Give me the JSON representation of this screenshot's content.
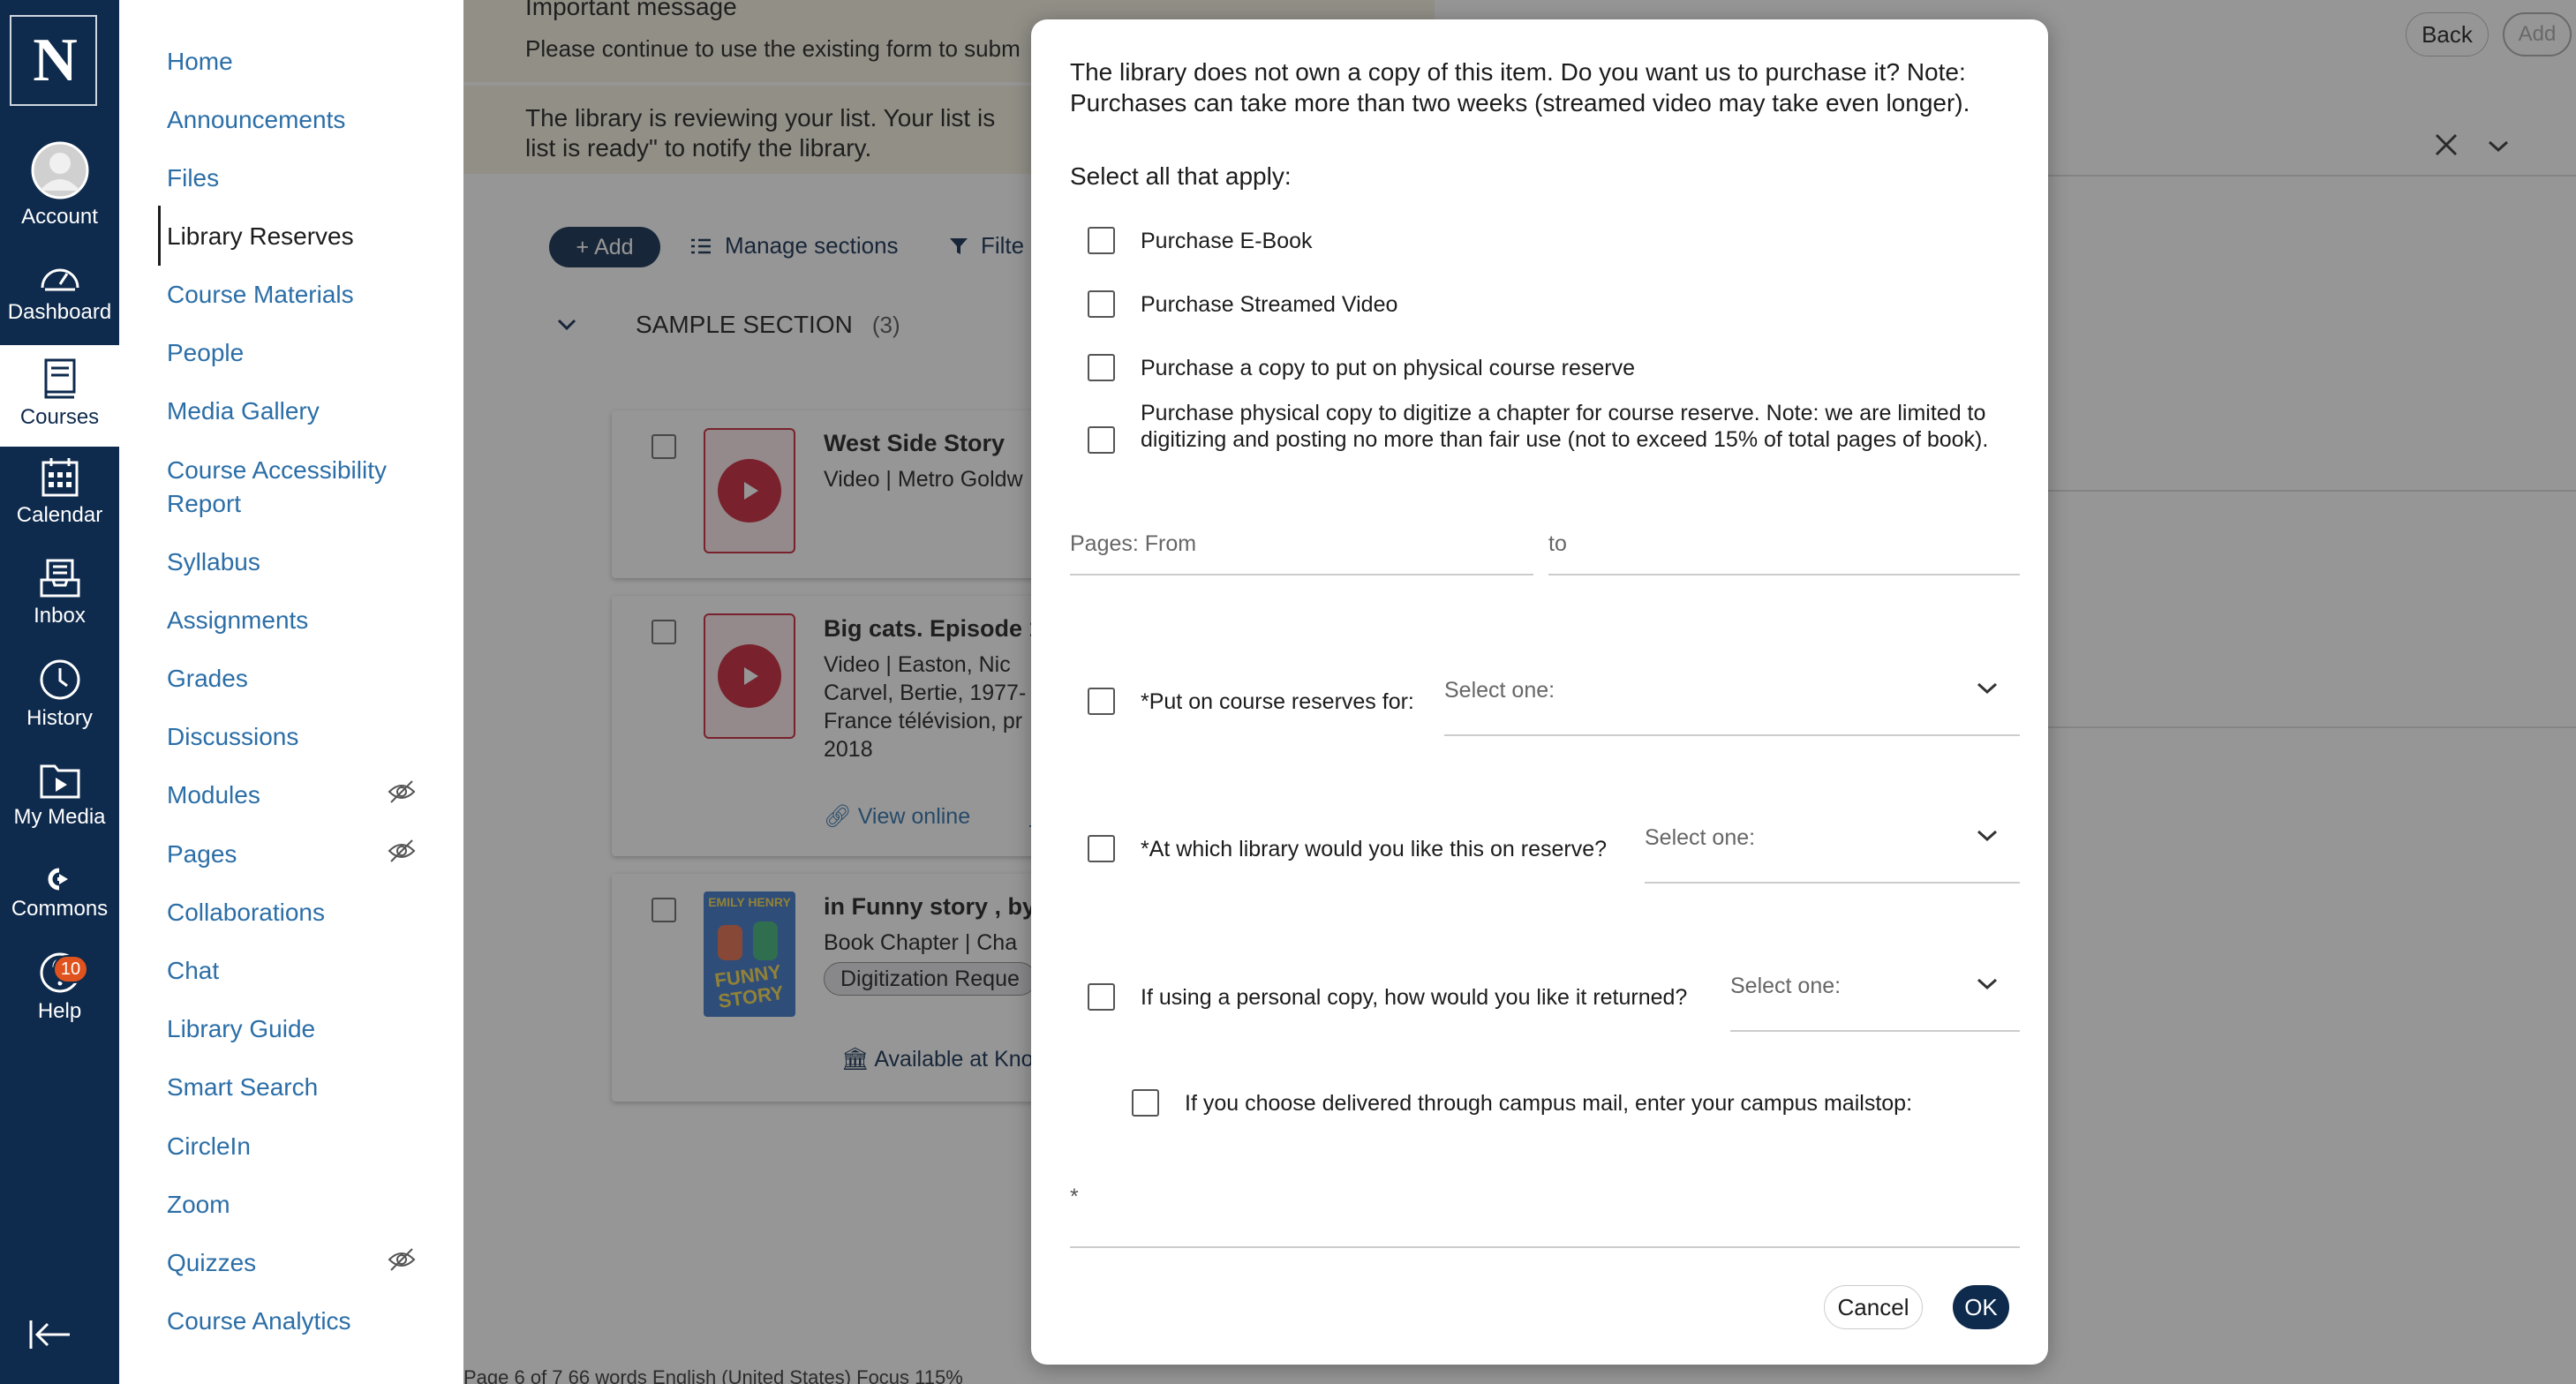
{
  "global_nav": {
    "items": [
      {
        "label": "Account",
        "icon": "account-avatar-icon"
      },
      {
        "label": "Dashboard",
        "icon": "dashboard-gauge-icon"
      },
      {
        "label": "Courses",
        "icon": "courses-book-icon",
        "active": true
      },
      {
        "label": "Calendar",
        "icon": "calendar-icon"
      },
      {
        "label": "Inbox",
        "icon": "inbox-icon"
      },
      {
        "label": "History",
        "icon": "history-clock-icon"
      },
      {
        "label": "My Media",
        "icon": "my-media-folder-icon"
      },
      {
        "label": "Commons",
        "icon": "commons-icon"
      },
      {
        "label": "Help",
        "icon": "help-icon",
        "badge": "10"
      }
    ],
    "logo_text": "N"
  },
  "course_nav": {
    "items": [
      {
        "label": "Home"
      },
      {
        "label": "Announcements"
      },
      {
        "label": "Files"
      },
      {
        "label": "Library Reserves",
        "active": true
      },
      {
        "label": "Course Materials"
      },
      {
        "label": "People"
      },
      {
        "label": "Media Gallery"
      },
      {
        "label": "Course Accessibility Report"
      },
      {
        "label": "Syllabus"
      },
      {
        "label": "Assignments"
      },
      {
        "label": "Grades"
      },
      {
        "label": "Discussions"
      },
      {
        "label": "Modules",
        "hidden": true
      },
      {
        "label": "Pages",
        "hidden": true
      },
      {
        "label": "Collaborations"
      },
      {
        "label": "Chat"
      },
      {
        "label": "Library Guide"
      },
      {
        "label": "Smart Search"
      },
      {
        "label": "CircleIn"
      },
      {
        "label": "Zoom"
      },
      {
        "label": "Quizzes",
        "hidden": true
      },
      {
        "label": "Course Analytics"
      }
    ]
  },
  "main": {
    "notice_title": "Important message",
    "notice_body": "Please continue to use the existing form to subm",
    "review_text": "The library is reviewing your list. Your list is list is ready\" to notify the library.",
    "toolbar": {
      "add": "Add",
      "manage": "Manage sections",
      "filter": "Filte"
    },
    "section": {
      "name": "SAMPLE SECTION",
      "count": "(3)"
    },
    "cards": [
      {
        "title": "West Side Story",
        "meta": "Video  |  Metro Goldw"
      },
      {
        "title": "Big cats. Episode 1",
        "meta_lines": [
          "Video  |  Easton, Nic",
          "Carvel, Bertie, 1977-",
          "France télévision, pr",
          "2018"
        ],
        "link": "View online",
        "link2": "Mo"
      },
      {
        "title": "in Funny story , by",
        "meta": "Book Chapter  |  Cha",
        "pill": "Digitization Reque",
        "availability": "Available at Kno",
        "cover_top": "EMILY HENRY",
        "cover_title": "FUNNY STORY"
      }
    ],
    "right_panel": {
      "back": "Back",
      "add": "Add"
    },
    "status_bar": "Page 6 of 7   66 words        English (United States)           Focus                              115%"
  },
  "modal": {
    "intro": "The library does not own a copy of this item. Do you want us to purchase it? Note: Purchases can take more than two weeks (streamed video may take even longer).",
    "select_all": "Select all that apply:",
    "options": [
      {
        "label": "Purchase E-Book",
        "checked": false
      },
      {
        "label": "Purchase Streamed Video",
        "checked": false
      },
      {
        "label": "Purchase a copy to put on physical course reserve",
        "checked": false
      },
      {
        "label": "Purchase physical copy to digitize a chapter for course reserve. Note: we are limited to digitizing and posting no more than fair use (not to exceed 15% of total pages of book).",
        "checked": false
      }
    ],
    "pages_from_placeholder": "Pages: From",
    "pages_to_placeholder": "to",
    "reserve_for": {
      "label": "*Put on course reserves for:",
      "value": "Select one:"
    },
    "which_library": {
      "label": "*At which library would you like this on reserve?",
      "value": "Select one:"
    },
    "personal_copy": {
      "label": "If using a personal copy, how would you like it returned?",
      "value": "Select one:"
    },
    "campus_mail": {
      "label": "If you choose delivered through campus mail, enter your campus mailstop:"
    },
    "mailstop_placeholder": "*",
    "cancel": "Cancel",
    "ok": "OK"
  }
}
